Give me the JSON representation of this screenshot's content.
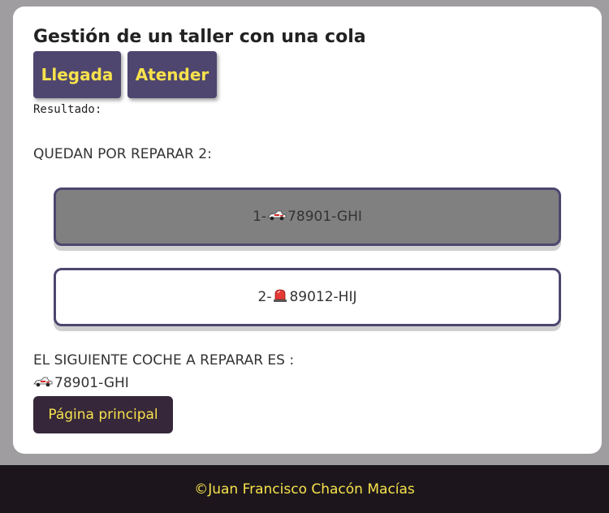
{
  "header": {
    "title": "Gestión de un taller con una cola"
  },
  "actions": {
    "llegada_label": "Llegada",
    "atender_label": "Atender"
  },
  "result": {
    "label": "Resultado:"
  },
  "queue": {
    "heading": "QUEDAN POR REPARAR 2:",
    "items": [
      {
        "index": "1-",
        "icon": "race-car-icon",
        "plate": "78901-GHI",
        "highlighted": true
      },
      {
        "index": "2-",
        "icon": "police-light-icon",
        "plate": "89012-HIJ",
        "highlighted": false
      }
    ]
  },
  "next": {
    "heading": "EL SIGUIENTE COCHE A REPARAR ES :",
    "icon": "race-car-icon",
    "plate": "78901-GHI"
  },
  "nav": {
    "home_label": "Página principal"
  },
  "footer": {
    "text": "©Juan Francisco Chacón Macías"
  },
  "colors": {
    "button_bg": "#4e466f",
    "button_text": "#f7e24c",
    "home_button_bg": "#36273a",
    "footer_bg": "#1c161c",
    "highlight_bg": "#808080"
  }
}
